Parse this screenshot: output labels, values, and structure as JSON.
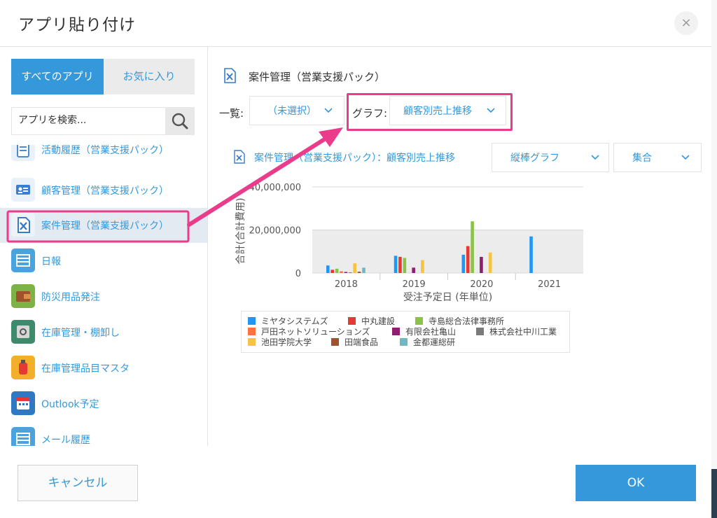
{
  "dialog": {
    "title": "アプリ貼り付け",
    "close_symbol": "×"
  },
  "sidebar": {
    "tabs": [
      {
        "label": "すべてのアプリ",
        "active": true
      },
      {
        "label": "お気に入り",
        "active": false
      }
    ],
    "search": {
      "placeholder": "アプリを検索..."
    },
    "items": [
      {
        "label": "活動履歴（営業支援パック）",
        "icon": "activity-history-icon",
        "color": "#4a8bd6"
      },
      {
        "label": "顧客管理（営業支援パック）",
        "icon": "contact-card-icon",
        "color": "#3b7fd0"
      },
      {
        "label": "案件管理（営業支援パック）",
        "icon": "spreadsheet-doc-icon",
        "color": "#3a7bc8",
        "selected": true
      },
      {
        "label": "日報",
        "icon": "list-icon",
        "color": "#4aa3df"
      },
      {
        "label": "防災用品発注",
        "icon": "wallet-icon",
        "color": "#7db346"
      },
      {
        "label": "在庫管理・棚卸し",
        "icon": "safe-icon",
        "color": "#3e8a6d"
      },
      {
        "label": "在庫管理品目マスタ",
        "icon": "fire-extinguisher-icon",
        "color": "#f2b02a"
      },
      {
        "label": "Outlook予定",
        "icon": "calendar-icon",
        "color": "#2f78c4"
      },
      {
        "label": "メール履歴",
        "icon": "mail-list-icon",
        "color": "#4aa3df"
      }
    ]
  },
  "main": {
    "app_name": "案件管理（営業支援パック）",
    "list_label": "一覧:",
    "list_value": "（未選択）",
    "graph_label": "グラフ:",
    "graph_value": "顧客別売上推移",
    "graph_title": "案件管理（営業支援パック）：顧客別売上推移",
    "chart_type_value": "縦棒グラフ",
    "aggregation_value": "集合"
  },
  "chart_data": {
    "type": "bar",
    "categories": [
      "2018",
      "2019",
      "2020",
      "2021"
    ],
    "xlabel": "受注予定日 (年単位)",
    "ylabel": "合計(合計費用)",
    "ylim": [
      0,
      40000000
    ],
    "yticks": [
      "0",
      "20,000,000",
      "40,000,000"
    ],
    "legend_position": "bottom",
    "series": [
      {
        "name": "ミヤタシステムズ",
        "color": "#2196f3",
        "values": [
          3500000,
          8000000,
          8500000,
          17000000
        ]
      },
      {
        "name": "中丸建設",
        "color": "#e53935",
        "values": [
          1500000,
          7500000,
          12500000,
          0
        ]
      },
      {
        "name": "寺島総合法律事務所",
        "color": "#8bc34a",
        "values": [
          2000000,
          7000000,
          24000000,
          0
        ]
      },
      {
        "name": "戸田ネットソリューションズ",
        "color": "#ff7043",
        "values": [
          800000,
          0,
          0,
          0
        ]
      },
      {
        "name": "有限会社亀山",
        "color": "#8e1e6e",
        "values": [
          500000,
          2500000,
          7500000,
          0
        ]
      },
      {
        "name": "株式会社中川工業",
        "color": "#7a7a7a",
        "values": [
          300000,
          0,
          0,
          0
        ]
      },
      {
        "name": "池田学院大学",
        "color": "#f6c343",
        "values": [
          4500000,
          6000000,
          9500000,
          0
        ]
      },
      {
        "name": "田端食品",
        "color": "#a0522d",
        "values": [
          600000,
          0,
          0,
          0
        ]
      },
      {
        "name": "金都運総研",
        "color": "#6fb7c2",
        "values": [
          2500000,
          0,
          0,
          0
        ]
      }
    ]
  },
  "footer": {
    "cancel_label": "キャンセル",
    "ok_label": "OK"
  }
}
